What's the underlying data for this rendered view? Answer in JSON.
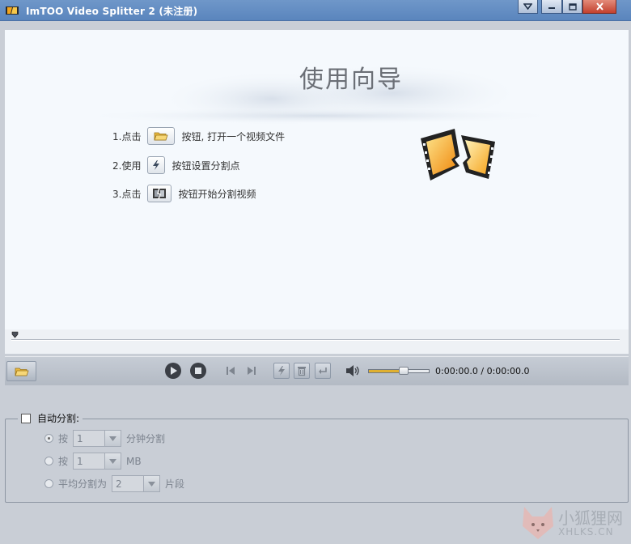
{
  "window": {
    "title": "ImTOO Video Splitter 2 (未注册)",
    "buttons": [
      "dropdown-icon",
      "minimize-icon",
      "restore-icon",
      "close-icon"
    ]
  },
  "guide": {
    "title": "使用向导",
    "steps": [
      {
        "prefix": "1.点击",
        "icon": "folder-open-icon",
        "suffix": "按钮, 打开一个视频文件"
      },
      {
        "prefix": "2.使用",
        "icon": "split-lightning-icon",
        "suffix": "按钮设置分割点"
      },
      {
        "prefix": "3.点击",
        "icon": "split-film-icon",
        "suffix": "按钮开始分割视频"
      }
    ]
  },
  "player": {
    "time": "0:00:00.0 / 0:00:00.0",
    "volume": 0.6,
    "icons": [
      "folder-open-icon",
      "play-icon",
      "stop-icon",
      "prev-frame-icon",
      "next-frame-icon",
      "split-icon",
      "delete-icon",
      "enter-icon",
      "speaker-icon"
    ]
  },
  "auto_split": {
    "label": "自动分割:",
    "checked": false,
    "options": [
      {
        "prefix": "按",
        "value": "1",
        "suffix": "分钟分割",
        "selected": true
      },
      {
        "prefix": "按",
        "value": "1",
        "suffix": "MB",
        "selected": false
      },
      {
        "prefix": "平均分割为",
        "value": "2",
        "suffix": "片段",
        "selected": false
      }
    ]
  },
  "watermark": {
    "line1": "小狐狸网",
    "line2": "XHLKS.CN"
  },
  "colors": {
    "titlebar": "#5a85bd",
    "accent": "#e0b030",
    "preview_bg": "#f5f9fd"
  }
}
